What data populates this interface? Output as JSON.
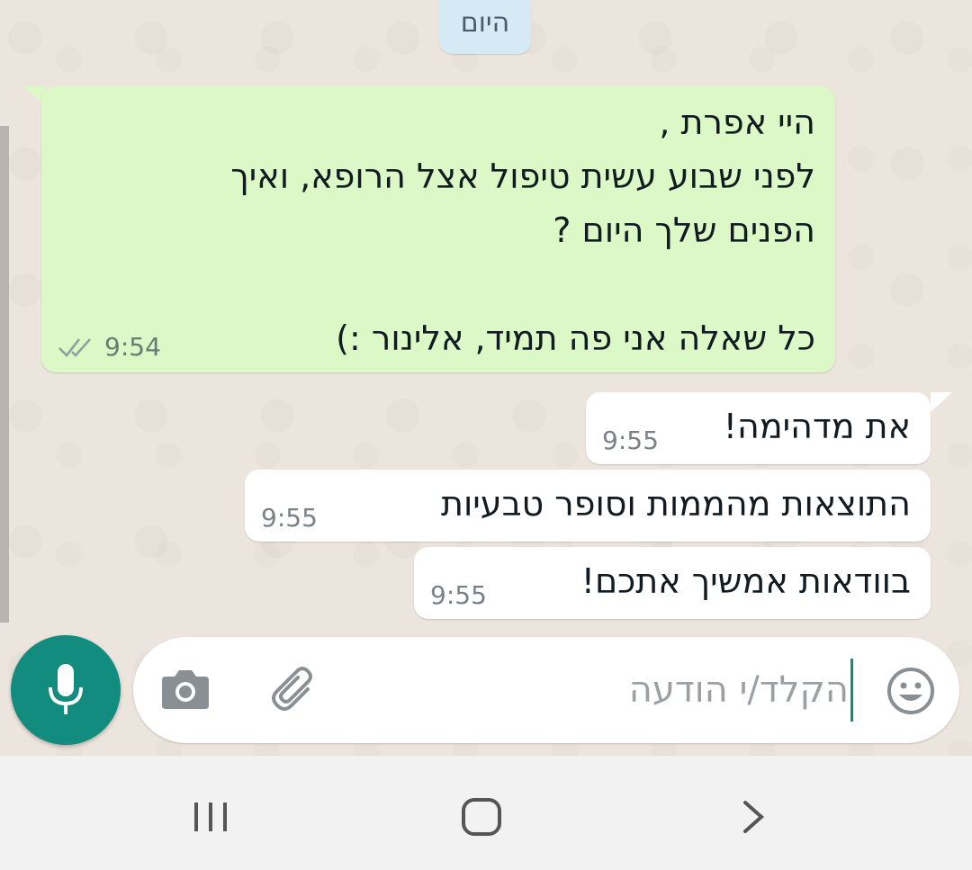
{
  "chat": {
    "date_chip": "היום",
    "outgoing": {
      "text": "היי אפרת ,\nלפני שבוע עשית טיפול אצל הרופא, ואיך\nהפנים שלך היום ?\n\nכל שאלה אני פה תמיד, אלינור :)",
      "time": "9:54",
      "status": "read-double-check"
    },
    "incoming": [
      {
        "text": "את מדהימה!",
        "time": "9:55"
      },
      {
        "text": "התוצאות מהממות וסופר טבעיות",
        "time": "9:55"
      },
      {
        "text": "בוודאות אמשיך אתכם!",
        "time": "9:55"
      }
    ]
  },
  "composer": {
    "placeholder": "הקלד/י הודעה",
    "icons": [
      "emoji-icon",
      "paperclip-icon",
      "camera-icon",
      "microphone-icon"
    ]
  },
  "nav": {
    "icons": [
      "recent-apps-icon",
      "home-icon",
      "back-icon"
    ]
  },
  "colors": {
    "outgoing_bubble": "#dcf8c6",
    "incoming_bubble": "#ffffff",
    "accent": "#128c7e",
    "date_chip": "#d5eaf5"
  }
}
